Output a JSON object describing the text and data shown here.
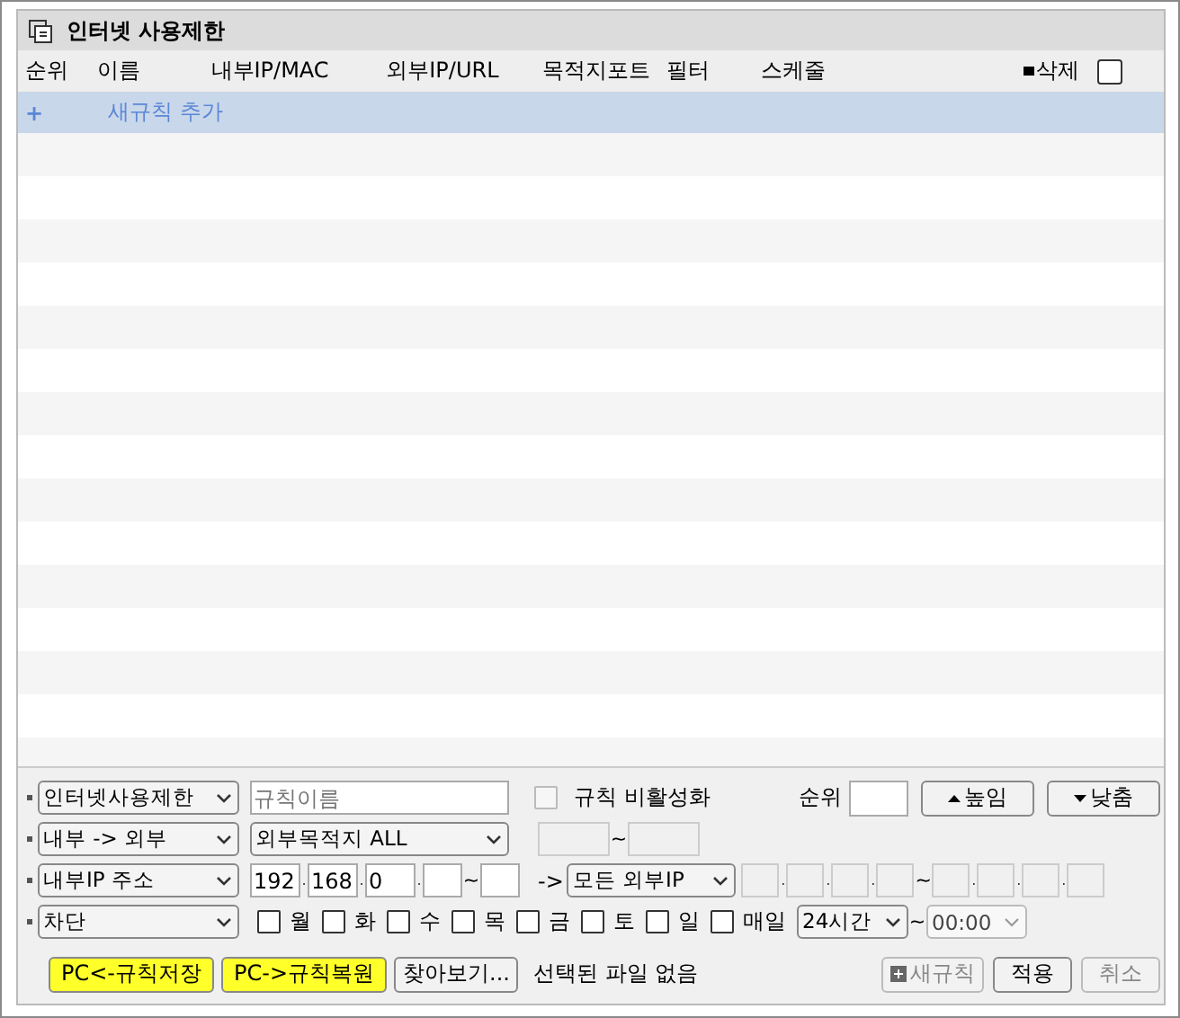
{
  "window": {
    "title": "인터넷 사용제한"
  },
  "table": {
    "columns": [
      "순위",
      "이름",
      "내부IP/MAC",
      "외부IP/URL",
      "목적지포트",
      "필터",
      "스케줄"
    ],
    "delete_label": "삭제",
    "delete_all_checked": false,
    "add_row": {
      "icon": "+",
      "label": "새규칙 추가"
    }
  },
  "form": {
    "category": "인터넷사용제한",
    "rule_name_placeholder": "규칙이름",
    "disable_rule": {
      "label": "규칙 비활성화",
      "checked": false,
      "disabled": true
    },
    "priority_label": "순위",
    "raise_button": "높임",
    "lower_button": "낮춤",
    "direction": "내부 -> 외부",
    "destination": "외부목적지 ALL",
    "port_tilde": "~",
    "source_type": "내부IP 주소",
    "ip_octets": [
      "192",
      "168",
      "0"
    ],
    "ip_separator": ".",
    "ip_tilde": "~",
    "arrow": "->",
    "dest_type": "모든 외부IP",
    "dest_tilde": "~",
    "action": "차단",
    "days": [
      {
        "label": "월",
        "checked": false
      },
      {
        "label": "화",
        "checked": false
      },
      {
        "label": "수",
        "checked": false
      },
      {
        "label": "목",
        "checked": false
      },
      {
        "label": "금",
        "checked": false
      },
      {
        "label": "토",
        "checked": false
      },
      {
        "label": "일",
        "checked": false
      },
      {
        "label": "매일",
        "checked": false
      }
    ],
    "time_mode": "24시간",
    "time_tilde": "~",
    "time": {
      "value": "00:00",
      "disabled": true
    }
  },
  "footer": {
    "buttons": [
      {
        "label": "PC<-규칙저장",
        "kind": "highlight"
      },
      {
        "label": "PC->규칙복원",
        "kind": "highlight"
      },
      {
        "label": "찾아보기...",
        "kind": "normal"
      }
    ],
    "file_status": "선택된 파일 없음",
    "actions": [
      {
        "label": "새규칙",
        "kind": "new",
        "disabled": true
      },
      {
        "label": "적용",
        "kind": "plain",
        "disabled": false
      },
      {
        "label": "취소",
        "kind": "plain",
        "disabled": true
      }
    ]
  }
}
